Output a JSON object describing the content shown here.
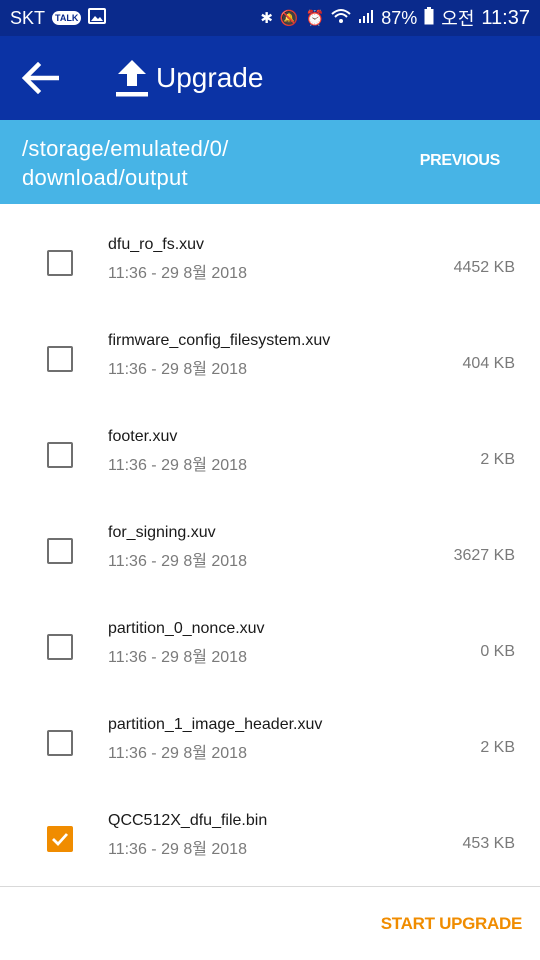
{
  "status_bar": {
    "carrier": "SKT",
    "talk_badge": "TALK",
    "battery": "87%",
    "ampm": "오전",
    "time": "11:37",
    "icons": [
      "talk-icon",
      "image-icon",
      "bluetooth-icon",
      "mute-icon",
      "alarm-icon",
      "wifi-icon",
      "signal-icon",
      "battery-icon"
    ]
  },
  "app_bar": {
    "title": "Upgrade",
    "back_icon": "arrow-left-icon",
    "title_icon": "upload-icon"
  },
  "path_bar": {
    "path": "/storage/emulated/0/ download/output",
    "previous_label": "PREVIOUS"
  },
  "files": [
    {
      "name": "dfu_ro_fs.xuv",
      "date": "11:36 - 29 8월 2018",
      "size": "4452 KB",
      "checked": false
    },
    {
      "name": "firmware_config_filesystem.xuv",
      "date": "11:36 - 29 8월 2018",
      "size": "404 KB",
      "checked": false
    },
    {
      "name": "footer.xuv",
      "date": "11:36 - 29 8월 2018",
      "size": "2 KB",
      "checked": false
    },
    {
      "name": "for_signing.xuv",
      "date": "11:36 - 29 8월 2018",
      "size": "3627 KB",
      "checked": false
    },
    {
      "name": "partition_0_nonce.xuv",
      "date": "11:36 - 29 8월 2018",
      "size": "0 KB",
      "checked": false
    },
    {
      "name": "partition_1_image_header.xuv",
      "date": "11:36 - 29 8월 2018",
      "size": "2 KB",
      "checked": false
    },
    {
      "name": "QCC512X_dfu_file.bin",
      "date": "11:36 - 29 8월 2018",
      "size": "453 KB",
      "checked": true
    }
  ],
  "footer": {
    "start_label": "START UPGRADE"
  },
  "colors": {
    "status_bar": "#0a2a8c",
    "app_bar": "#0b33a5",
    "path_bar": "#47b4e6",
    "accent": "#f08c00"
  }
}
